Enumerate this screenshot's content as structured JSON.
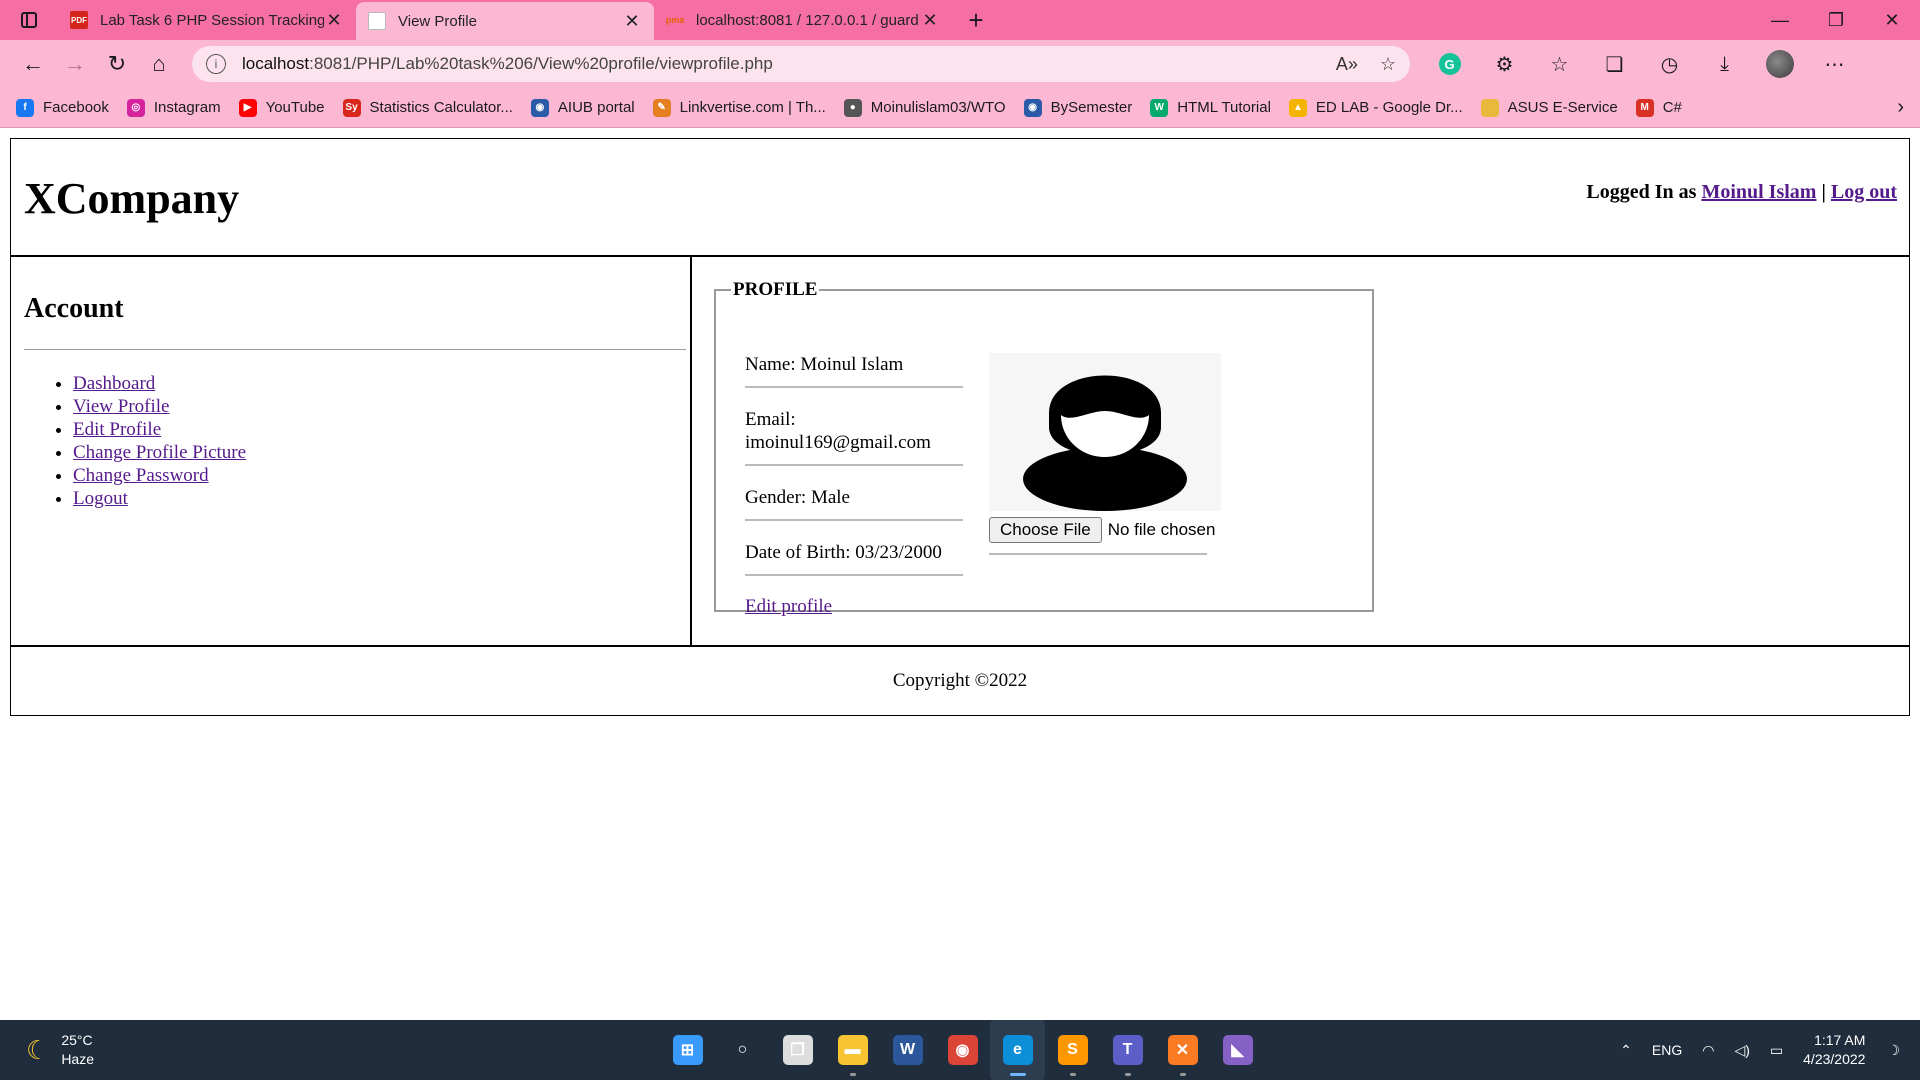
{
  "browser": {
    "tabs": [
      {
        "title": "Lab Task 6 PHP Session Tracking",
        "favicon": "pdf-icon",
        "active": false
      },
      {
        "title": "View Profile",
        "favicon": "page-icon",
        "active": true
      },
      {
        "title": "localhost:8081 / 127.0.0.1 / guard",
        "favicon": "phpmyadmin-icon",
        "active": false
      }
    ],
    "url": {
      "host": "localhost",
      "rest": ":8081/PHP/Lab%20task%206/View%20profile/viewprofile.php"
    },
    "bookmarks": [
      {
        "label": "Facebook",
        "icon": "facebook-icon",
        "color": "#1877f2",
        "glyph": "f"
      },
      {
        "label": "Instagram",
        "icon": "instagram-icon",
        "color": "#d6249f",
        "glyph": "◎"
      },
      {
        "label": "YouTube",
        "icon": "youtube-icon",
        "color": "#ff0000",
        "glyph": "▶"
      },
      {
        "label": "Statistics Calculator...",
        "icon": "statistics-icon",
        "color": "#d9261c",
        "glyph": "Sy"
      },
      {
        "label": "AIUB portal",
        "icon": "aiub-icon",
        "color": "#2a5aa8",
        "glyph": "◉"
      },
      {
        "label": "Linkvertise.com | Th...",
        "icon": "linkvertise-icon",
        "color": "#e67e22",
        "glyph": "✎"
      },
      {
        "label": "Moinulislam03/WTO",
        "icon": "github-icon",
        "color": "#555555",
        "glyph": "●"
      },
      {
        "label": "BySemester",
        "icon": "bysemester-icon",
        "color": "#2a5aa8",
        "glyph": "◉"
      },
      {
        "label": "HTML Tutorial",
        "icon": "w3schools-icon",
        "color": "#04aa6d",
        "glyph": "W"
      },
      {
        "label": "ED LAB - Google Dr...",
        "icon": "google-drive-icon",
        "color": "#f4b400",
        "glyph": "▲"
      },
      {
        "label": "ASUS E-Service",
        "icon": "folder-icon",
        "color": "#e8b93a",
        "glyph": ""
      },
      {
        "label": "C#",
        "icon": "gmail-icon",
        "color": "#d93025",
        "glyph": "M"
      }
    ]
  },
  "site": {
    "title": "XCompany",
    "login": {
      "prefix": "Logged In as ",
      "user": "Moinul Islam",
      "separator": " | ",
      "logout": "Log out"
    },
    "sidebar": {
      "heading": "Account",
      "items": [
        "Dashboard",
        "View Profile",
        "Edit Profile",
        "Change Profile Picture",
        "Change Password",
        "Logout"
      ]
    },
    "profile": {
      "legend": "PROFILE",
      "name": "Name: Moinul Islam",
      "email_label": "Email:",
      "email": "imoinul169@gmail.com",
      "gender": "Gender: Male",
      "dob": "Date of Birth: 03/23/2000",
      "edit_link": "Edit profile",
      "file_button": "Choose File",
      "file_status": "No file chosen"
    },
    "footer": "Copyright ©2022"
  },
  "taskbar": {
    "weather": {
      "temp": "25°C",
      "condition": "Haze"
    },
    "apps": [
      {
        "name": "windows-start-icon",
        "color": "#3a9bff",
        "glyph": "⊞",
        "active": false,
        "running": false
      },
      {
        "name": "search-icon",
        "color": "#1f2d3d",
        "glyph": "○",
        "active": false,
        "running": false
      },
      {
        "name": "task-view-icon",
        "color": "#dddddd",
        "glyph": "❐",
        "active": false,
        "running": false
      },
      {
        "name": "file-explorer-icon",
        "color": "#f7c531",
        "glyph": "▬",
        "active": false,
        "running": true
      },
      {
        "name": "word-icon",
        "color": "#2b579a",
        "glyph": "W",
        "active": false,
        "running": false
      },
      {
        "name": "chrome-icon",
        "color": "#db4437",
        "glyph": "◉",
        "active": false,
        "running": false
      },
      {
        "name": "edge-icon",
        "color": "#0c8fd6",
        "glyph": "e",
        "active": true,
        "running": true
      },
      {
        "name": "sublime-text-icon",
        "color": "#ff9800",
        "glyph": "S",
        "active": false,
        "running": true
      },
      {
        "name": "teams-icon",
        "color": "#5b5fc7",
        "glyph": "T",
        "active": false,
        "running": true
      },
      {
        "name": "xampp-icon",
        "color": "#fb7a24",
        "glyph": "✕",
        "active": false,
        "running": true
      },
      {
        "name": "visual-studio-icon",
        "color": "#8661c5",
        "glyph": "◣",
        "active": false,
        "running": false
      }
    ],
    "tray": {
      "language": "ENG",
      "time": "1:17 AM",
      "date": "4/23/2022"
    }
  }
}
